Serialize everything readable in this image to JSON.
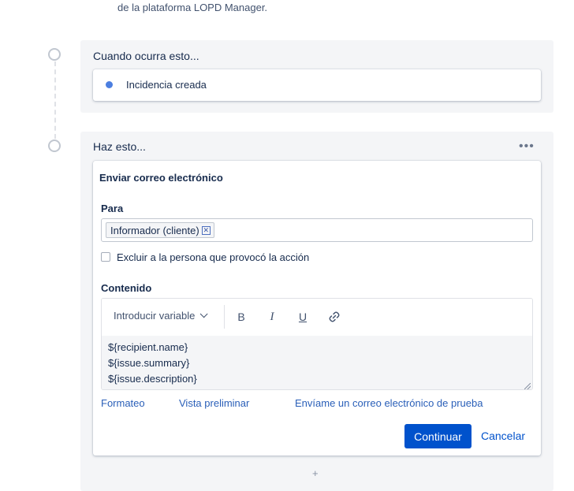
{
  "intro": {
    "text": "de la plataforma LOPD Manager."
  },
  "trigger": {
    "title": "Cuando ocurra esto...",
    "item_label": "Incidencia creada"
  },
  "action": {
    "title": "Haz esto...",
    "more_icon": "more-horizontal-icon",
    "more_glyph": "•••",
    "card_title": "Enviar correo electrónico",
    "to": {
      "label": "Para",
      "chips": [
        "Informador (cliente)"
      ],
      "chip_close_glyph": "✕"
    },
    "exclude_checkbox": {
      "label": "Excluir a la persona que provocó la acción",
      "checked": false
    },
    "content": {
      "label": "Contenido",
      "toolbar": {
        "variable_select": "Introducir variable",
        "bold": "B",
        "italic": "I",
        "underline": "U",
        "link_icon": "link-icon"
      },
      "lines": [
        "${recipient.name}",
        "${issue.summary}",
        "${issue.description}"
      ]
    },
    "links": {
      "formatting": "Formateo",
      "preview": "Vista preliminar",
      "test_email": "Envíame un correo electrónico de prueba"
    },
    "buttons": {
      "continue": "Continuar",
      "cancel": "Cancelar"
    }
  },
  "add_step": {
    "glyph": "+"
  },
  "colors": {
    "primary": "#0052cc",
    "link": "#2a5fb8",
    "bullet": "#4c7fe0",
    "panel": "#f4f5f7"
  }
}
